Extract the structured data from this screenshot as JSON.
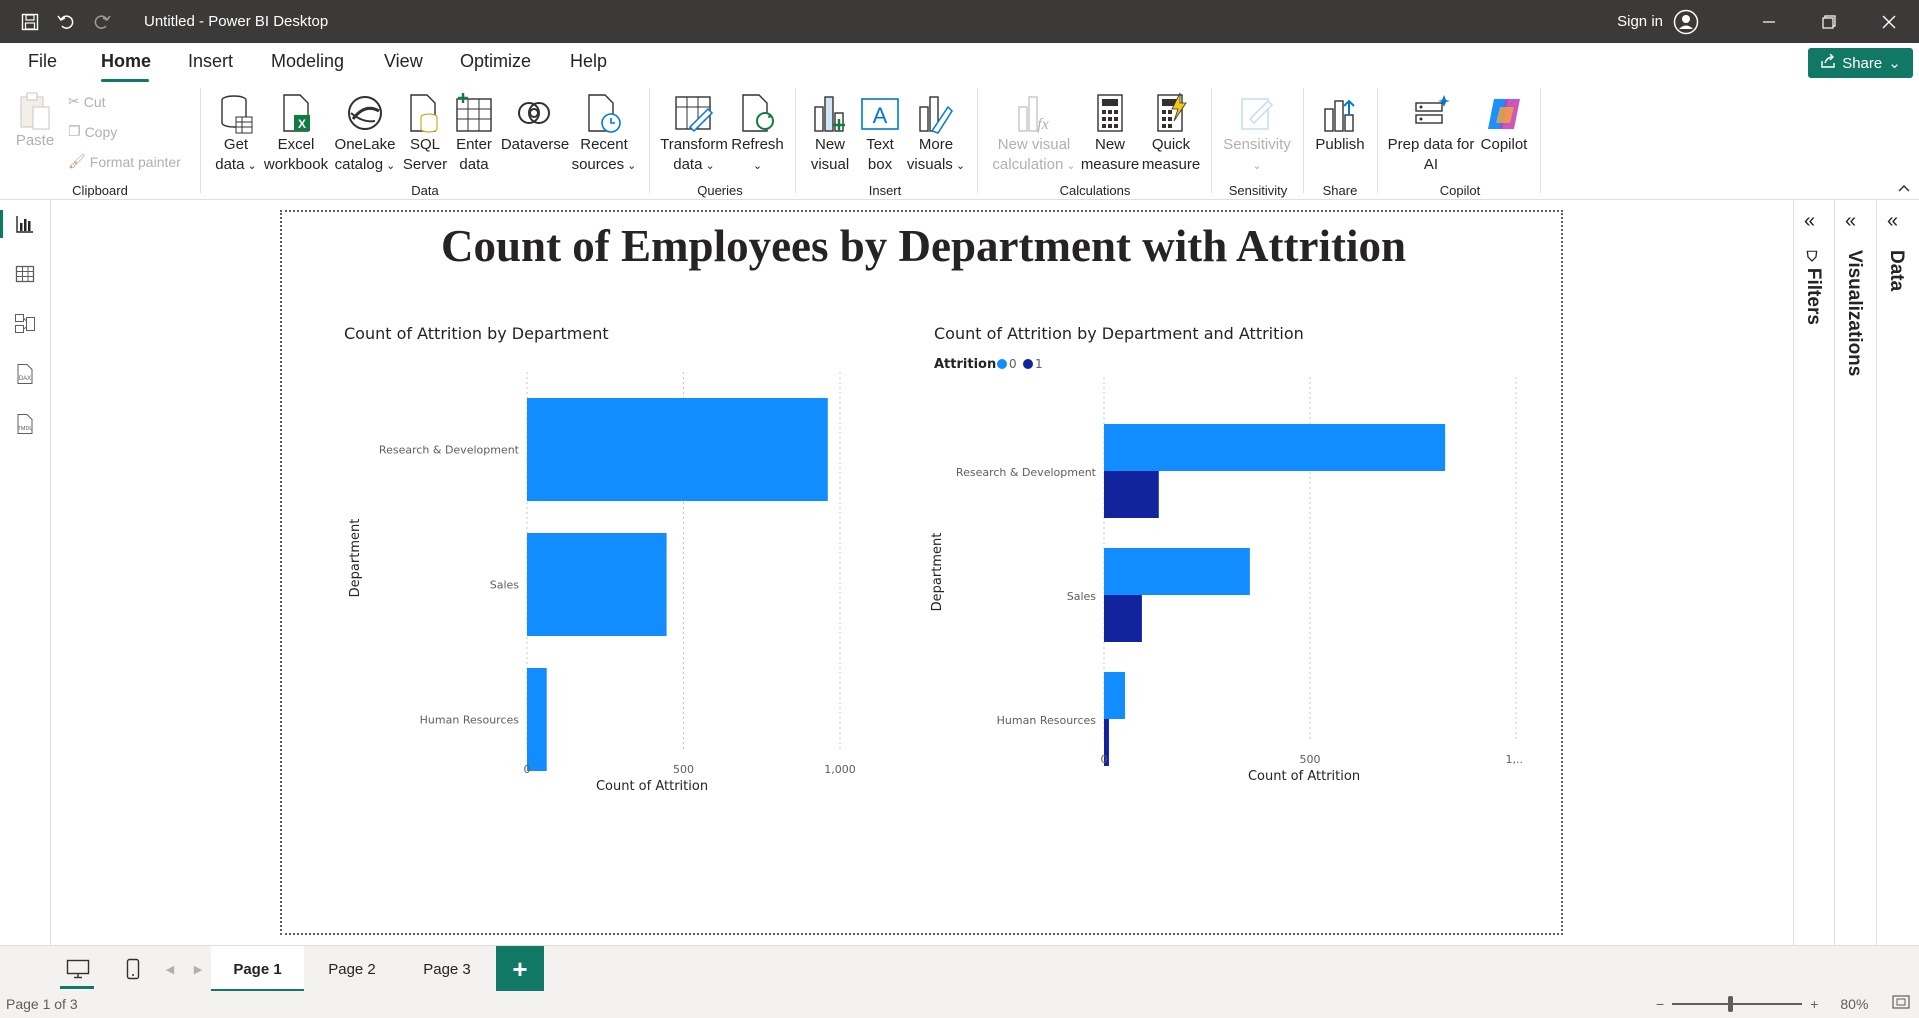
{
  "window": {
    "title": "Untitled - Power BI Desktop",
    "sign_in": "Sign in"
  },
  "menu": {
    "tabs": [
      "File",
      "Home",
      "Insert",
      "Modeling",
      "View",
      "Optimize",
      "Help"
    ],
    "active_tab": "Home",
    "share_label": "Share"
  },
  "ribbon": {
    "clipboard": {
      "paste": "Paste",
      "cut": "Cut",
      "copy": "Copy",
      "format_painter": "Format painter",
      "group_label": "Clipboard"
    },
    "data": {
      "get_data": [
        "Get",
        "data"
      ],
      "excel": [
        "Excel",
        "workbook"
      ],
      "onelake": [
        "OneLake",
        "catalog"
      ],
      "sql": [
        "SQL",
        "Server"
      ],
      "enter_data": [
        "Enter",
        "data"
      ],
      "dataverse": "Dataverse",
      "recent": [
        "Recent",
        "sources"
      ],
      "group_label": "Data"
    },
    "queries": {
      "transform": [
        "Transform",
        "data"
      ],
      "refresh": "Refresh",
      "group_label": "Queries"
    },
    "insert": {
      "new_visual": [
        "New",
        "visual"
      ],
      "text_box": [
        "Text",
        "box"
      ],
      "more_visuals": [
        "More",
        "visuals"
      ],
      "group_label": "Insert"
    },
    "calculations": {
      "new_visual_calc": [
        "New visual",
        "calculation"
      ],
      "new_measure": [
        "New",
        "measure"
      ],
      "quick_measure": [
        "Quick",
        "measure"
      ],
      "group_label": "Calculations"
    },
    "sensitivity": {
      "label": "Sensitivity",
      "group_label": "Sensitivity"
    },
    "share": {
      "publish": "Publish",
      "group_label": "Share"
    },
    "copilot": {
      "prep_data": [
        "Prep data for",
        "AI"
      ],
      "copilot": "Copilot",
      "group_label": "Copilot"
    }
  },
  "report": {
    "title": "Count of Employees by Department with Attrition"
  },
  "chart_data": [
    {
      "type": "bar",
      "orientation": "horizontal",
      "title": "Count of Attrition by Department",
      "categories": [
        "Research & Development",
        "Sales",
        "Human Resources"
      ],
      "values": [
        961,
        446,
        63
      ],
      "xlabel": "Count of Attrition",
      "ylabel": "Department",
      "xlim": [
        0,
        1000
      ],
      "x_ticks": [
        "0",
        "500",
        "1,000"
      ],
      "grid": "vertical dotted",
      "color": "#118DFF"
    },
    {
      "type": "bar",
      "orientation": "horizontal",
      "title": "Count of Attrition by Department and Attrition",
      "legend_title": "Attrition",
      "legend_position": "top-left",
      "categories": [
        "Research & Development",
        "Sales",
        "Human Resources"
      ],
      "series": [
        {
          "name": "0",
          "values": [
            828,
            354,
            51
          ],
          "color": "#118DFF"
        },
        {
          "name": "1",
          "values": [
            133,
            92,
            12
          ],
          "color": "#12239E"
        }
      ],
      "xlabel": "Count of Attrition",
      "ylabel": "Department",
      "xlim": [
        0,
        1000
      ],
      "x_ticks": [
        "0",
        "500",
        "1,..."
      ],
      "grid": "vertical dotted"
    }
  ],
  "panes": {
    "filters": "Filters",
    "visualizations": "Visualizations",
    "data": "Data"
  },
  "pages": {
    "tabs": [
      "Page 1",
      "Page 2",
      "Page 3"
    ],
    "active": "Page 1",
    "add_label": "+"
  },
  "status": {
    "page_info": "Page 1 of 3",
    "zoom": "80%",
    "zoom_fraction": 0.8
  }
}
